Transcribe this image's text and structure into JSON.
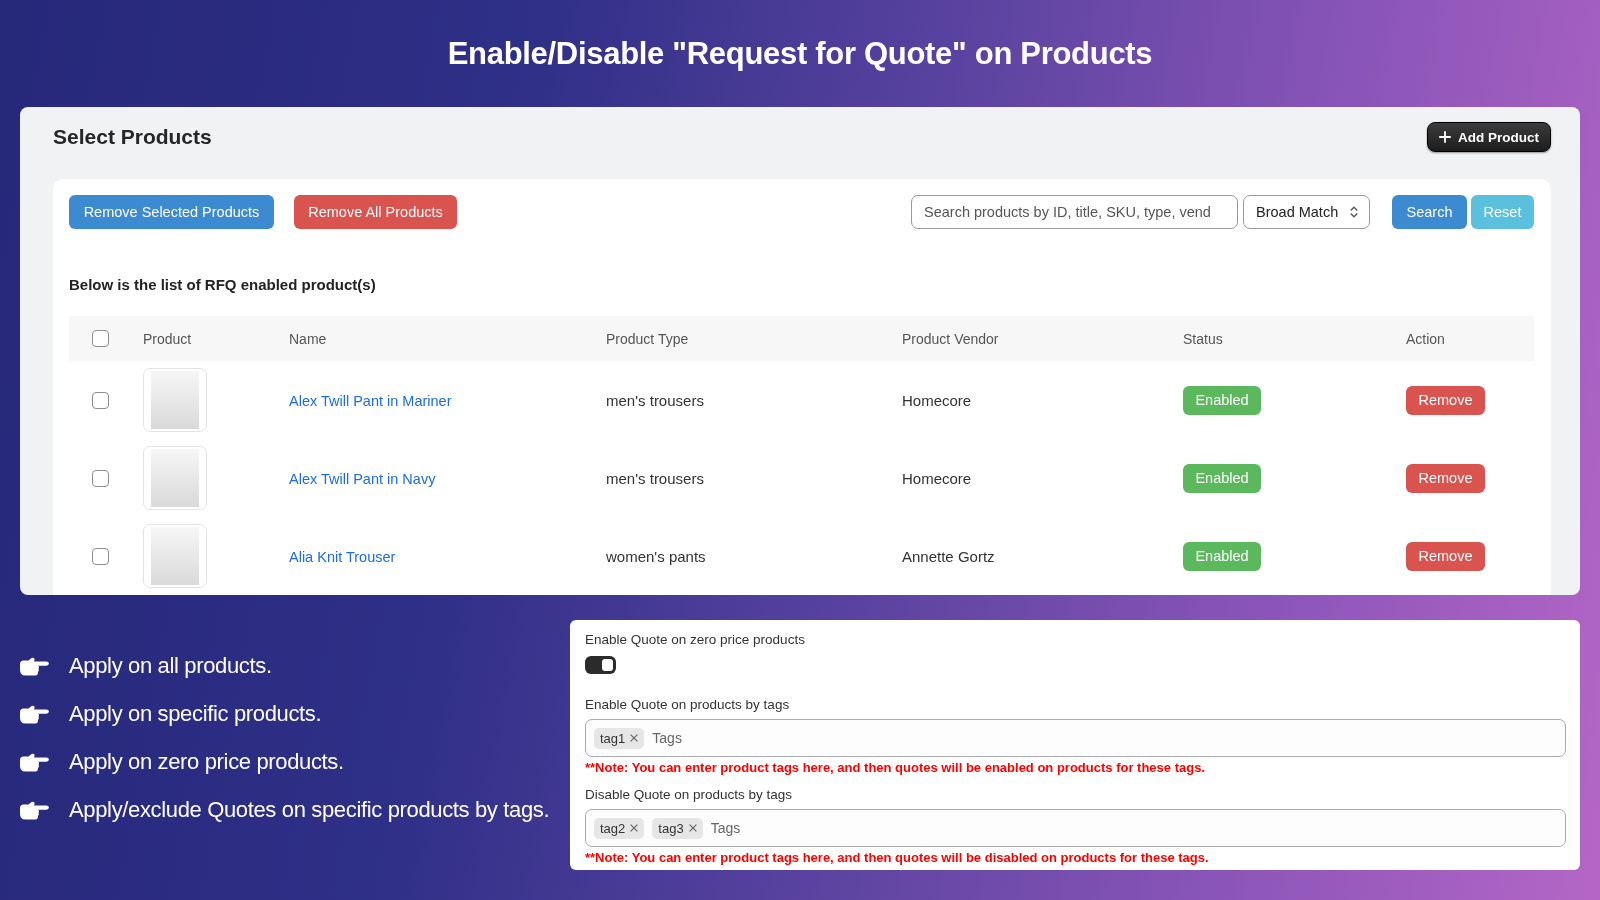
{
  "title": "Enable/Disable \"Request for Quote\" on Products",
  "products_panel": {
    "title": "Select Products",
    "add_button": "Add Product",
    "toolbar": {
      "buttons": [
        {
          "label": "Remove Selected Products",
          "kind": "primary"
        },
        {
          "label": "Remove All Products",
          "kind": "danger"
        }
      ],
      "search": {
        "placeholder": "Search products by ID, title, SKU, type, vend"
      },
      "match_select": {
        "value": "Broad Match"
      },
      "actions": [
        {
          "label": "Search",
          "kind": "primary"
        },
        {
          "label": "Reset",
          "kind": "info"
        }
      ]
    },
    "caption": "Below is the list of RFQ enabled product(s)",
    "table": {
      "select_all": {
        "checked": false
      },
      "columns": [
        "Product",
        "Name",
        "Product Type",
        "Product Vendor",
        "Status",
        "Action"
      ],
      "rows": [
        {
          "checked": false,
          "name": "Alex Twill Pant in Mariner",
          "type": "men's trousers",
          "vendor": "Homecore",
          "status": "Enabled",
          "action": "Remove"
        },
        {
          "checked": false,
          "name": "Alex Twill Pant in Navy",
          "type": "men's trousers",
          "vendor": "Homecore",
          "status": "Enabled",
          "action": "Remove"
        },
        {
          "checked": false,
          "name": "Alia Knit Trouser",
          "type": "women's pants",
          "vendor": "Annette Gortz",
          "status": "Enabled",
          "action": "Remove"
        }
      ]
    }
  },
  "features": [
    "Apply on all products.",
    "Apply on specific products.",
    "Apply on zero price products.",
    "Apply/exclude Quotes on specific products by tags."
  ],
  "settings_panel": {
    "zero_price": {
      "label": "Enable Quote on zero price products",
      "on": true
    },
    "tag_fields": [
      {
        "label": "Enable Quote on products by tags",
        "tags": [
          "tag1"
        ],
        "placeholder": "Tags",
        "note": "**Note: You can enter product tags here, and then quotes will be enabled on products for these tags."
      },
      {
        "label": "Disable Quote on products by tags",
        "tags": [
          "tag2",
          "tag3"
        ],
        "placeholder": "Tags",
        "note": "**Note: You can enter product tags here, and then quotes will be disabled on products for these tags."
      }
    ]
  }
}
